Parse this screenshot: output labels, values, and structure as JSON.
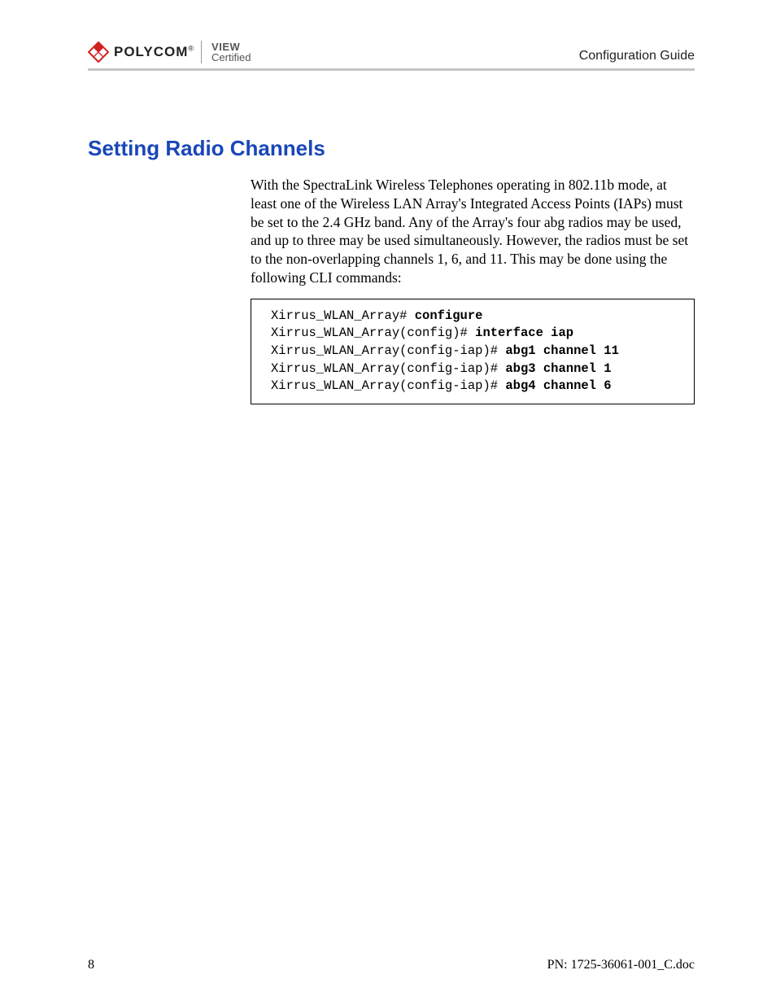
{
  "header": {
    "brand": "POLYCOM",
    "cert_line1": "VIEW",
    "cert_line2": "Certified",
    "right_text": "Configuration Guide"
  },
  "section": {
    "heading": "Setting Radio Channels",
    "paragraph": "With the SpectraLink Wireless Telephones operating in 802.11b mode, at least one of the Wireless LAN Array's Integrated Access Points (IAPs) must be set to the 2.4 GHz band. Any of the Array's four abg radios may be used, and up to three may be used simultaneously. However, the radios must be set to the non-overlapping channels 1, 6, and 11. This may be done using the following CLI commands:"
  },
  "code": {
    "lines": [
      {
        "prompt": "Xirrus_WLAN_Array# ",
        "cmd": "configure"
      },
      {
        "prompt": "Xirrus_WLAN_Array(config)# ",
        "cmd": "interface iap"
      },
      {
        "prompt": "Xirrus_WLAN_Array(config-iap)# ",
        "cmd": "abg1 channel 11"
      },
      {
        "prompt": "Xirrus_WLAN_Array(config-iap)# ",
        "cmd": "abg3 channel 1"
      },
      {
        "prompt": "Xirrus_WLAN_Array(config-iap)# ",
        "cmd": "abg4 channel 6"
      }
    ]
  },
  "footer": {
    "page_number": "8",
    "doc_id": "PN: 1725-36061-001_C.doc"
  }
}
